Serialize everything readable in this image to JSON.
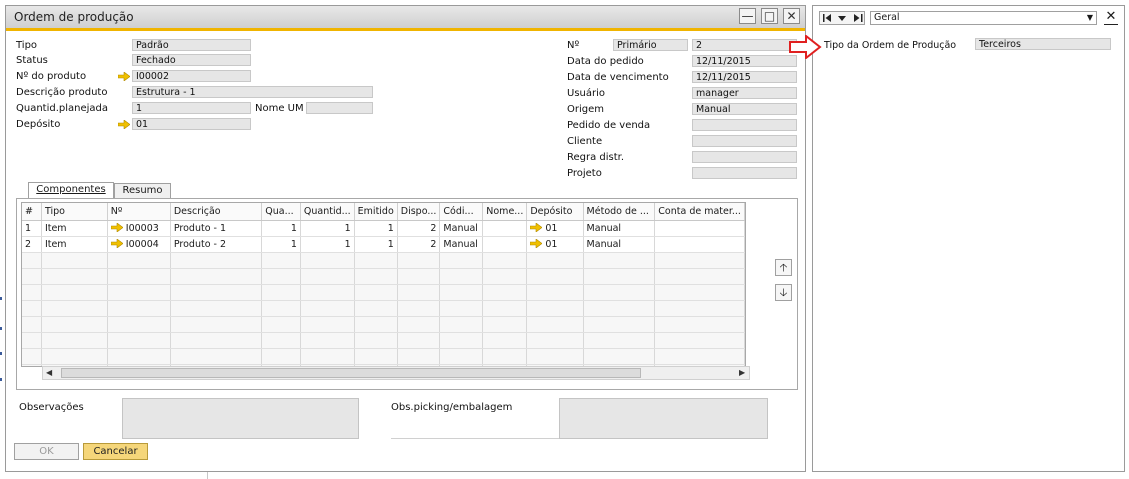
{
  "window": {
    "title": "Ordem de produção"
  },
  "header_left": [
    {
      "label": "Tipo",
      "value": "Padrão"
    },
    {
      "label": "Status",
      "value": "Fechado"
    },
    {
      "label": "Nº do produto",
      "value": "I00002"
    },
    {
      "label": "Descrição produto",
      "value": "Estrutura - 1"
    },
    {
      "label": "Quantid.planejada",
      "value": "1"
    },
    {
      "label": "Depósito",
      "value": "01"
    }
  ],
  "nome_um": {
    "label": "Nome UM",
    "value": ""
  },
  "header_right": {
    "no_label": "Nº",
    "no_series": "Primário",
    "no_value": "2",
    "fields": [
      {
        "label": "Data do pedido",
        "value": "12/11/2015"
      },
      {
        "label": "Data de vencimento",
        "value": "12/11/2015"
      },
      {
        "label": "Usuário",
        "value": "manager"
      },
      {
        "label": "Origem",
        "value": "Manual"
      },
      {
        "label": "Pedido de venda",
        "value": ""
      },
      {
        "label": "Cliente",
        "value": ""
      },
      {
        "label": "Regra distr.",
        "value": ""
      },
      {
        "label": "Projeto",
        "value": ""
      }
    ]
  },
  "tabs": [
    {
      "label": "Componentes"
    },
    {
      "label": "Resumo"
    }
  ],
  "grid": {
    "columns": [
      "#",
      "Tipo",
      "Nº",
      "Descrição",
      "Qua...",
      "Quantid...",
      "Emitido",
      "Dispo...",
      "Códi...",
      "Nome...",
      "Depósito",
      "Método de ...",
      "Conta de mater..."
    ],
    "rows": [
      [
        "1",
        "Item",
        "I00003",
        "Produto - 1",
        "1",
        "1",
        "1",
        "2",
        "Manual",
        "",
        "01",
        "Manual",
        ""
      ],
      [
        "2",
        "Item",
        "I00004",
        "Produto - 2",
        "1",
        "1",
        "1",
        "2",
        "Manual",
        "",
        "01",
        "Manual",
        ""
      ]
    ]
  },
  "footer": {
    "observacoes_label": "Observações",
    "obs_picking_label": "Obs.picking/embalagem",
    "ok_label": "OK",
    "cancel_label": "Cancelar"
  },
  "side_panel": {
    "dropdown_value": "Geral",
    "field_label": "Tipo da Ordem de Produção",
    "field_value": "Terceiros"
  },
  "colors": {
    "accent": "#f0b400",
    "cancel_button": "#f5d67a",
    "arrow": "#f0c000",
    "callout": "#e02020"
  }
}
